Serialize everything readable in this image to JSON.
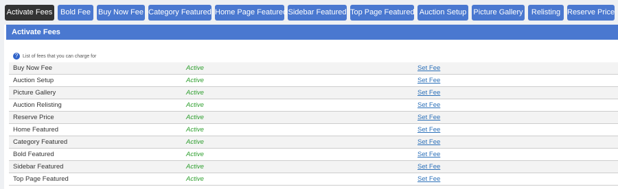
{
  "tabs": [
    {
      "label": "Activate Fees",
      "active": true
    },
    {
      "label": "Bold Fee",
      "active": false
    },
    {
      "label": "Buy Now Fee",
      "active": false
    },
    {
      "label": "Category Featured",
      "active": false
    },
    {
      "label": "Home Page Featured",
      "active": false
    },
    {
      "label": "Sidebar Featured",
      "active": false
    },
    {
      "label": "Top Page Featured",
      "active": false
    },
    {
      "label": "Auction Setup",
      "active": false
    },
    {
      "label": "Picture Gallery",
      "active": false
    },
    {
      "label": "Relisting",
      "active": false
    },
    {
      "label": "Reserve Price",
      "active": false
    }
  ],
  "panel": {
    "title": "Activate Fees",
    "info_icon": "help-icon",
    "info_text": "List of fees that you can charge for"
  },
  "fees": [
    {
      "name": "Buy Now Fee",
      "status": "Active",
      "action": "Set Fee"
    },
    {
      "name": "Auction Setup",
      "status": "Active",
      "action": "Set Fee"
    },
    {
      "name": "Picture Gallery",
      "status": "Active",
      "action": "Set Fee"
    },
    {
      "name": "Auction Relisting",
      "status": "Active",
      "action": "Set Fee"
    },
    {
      "name": "Reserve Price",
      "status": "Active",
      "action": "Set Fee"
    },
    {
      "name": "Home Featured",
      "status": "Active",
      "action": "Set Fee"
    },
    {
      "name": "Category Featured",
      "status": "Active",
      "action": "Set Fee"
    },
    {
      "name": "Bold Featured",
      "status": "Active",
      "action": "Set Fee"
    },
    {
      "name": "Sidebar Featured",
      "status": "Active",
      "action": "Set Fee"
    },
    {
      "name": "Top Page Featured",
      "status": "Active",
      "action": "Set Fee"
    }
  ],
  "colors": {
    "tab_blue": "#4a78d0",
    "tab_active": "#333333",
    "status_green": "#2e9f2e",
    "link_blue": "#2a6fb8"
  }
}
